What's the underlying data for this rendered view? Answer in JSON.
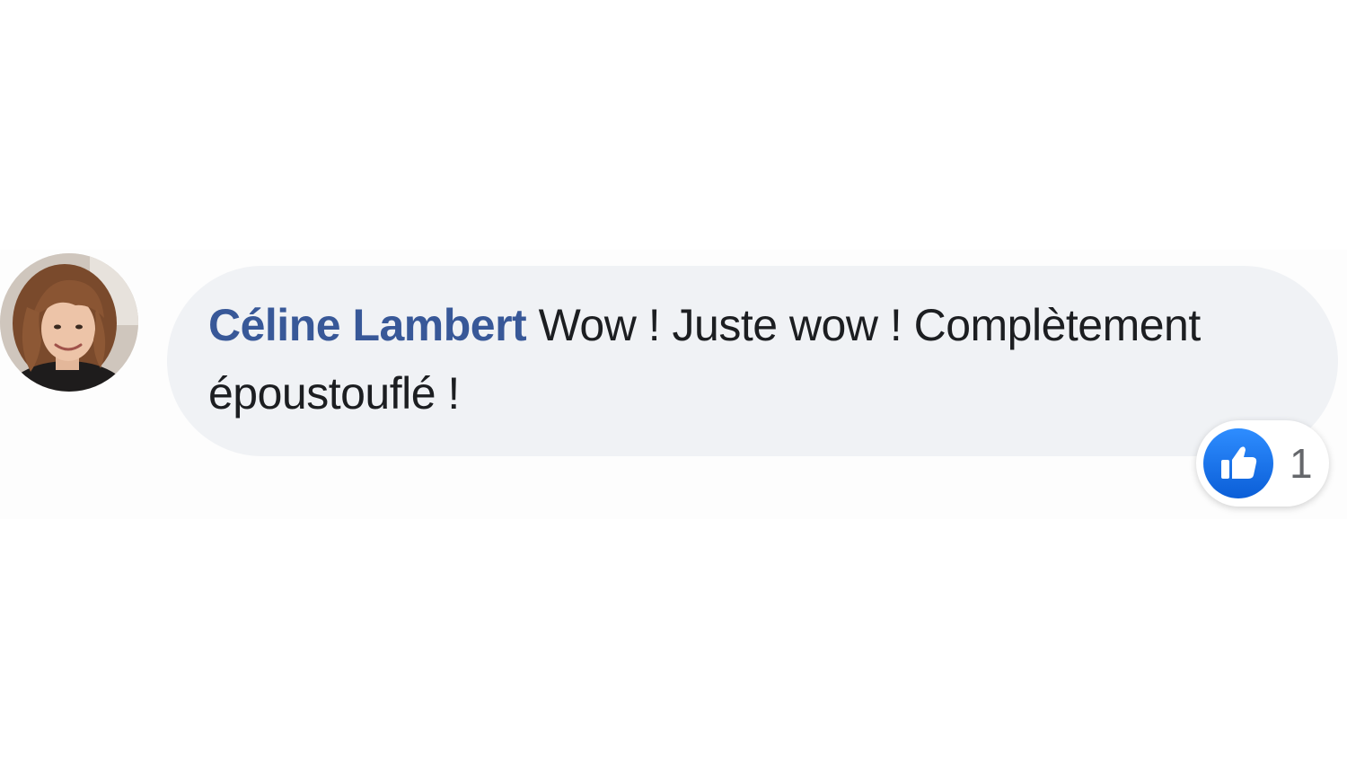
{
  "comment": {
    "author": "Céline Lambert",
    "text": "Wow ! Juste wow ! Complètement époustouflé !",
    "reactions": {
      "icon": "like-icon",
      "count": "1",
      "color": "#1877f2"
    }
  },
  "colors": {
    "author_name": "#385898",
    "bubble_background": "#f0f2f5",
    "text": "#1c1e21"
  }
}
